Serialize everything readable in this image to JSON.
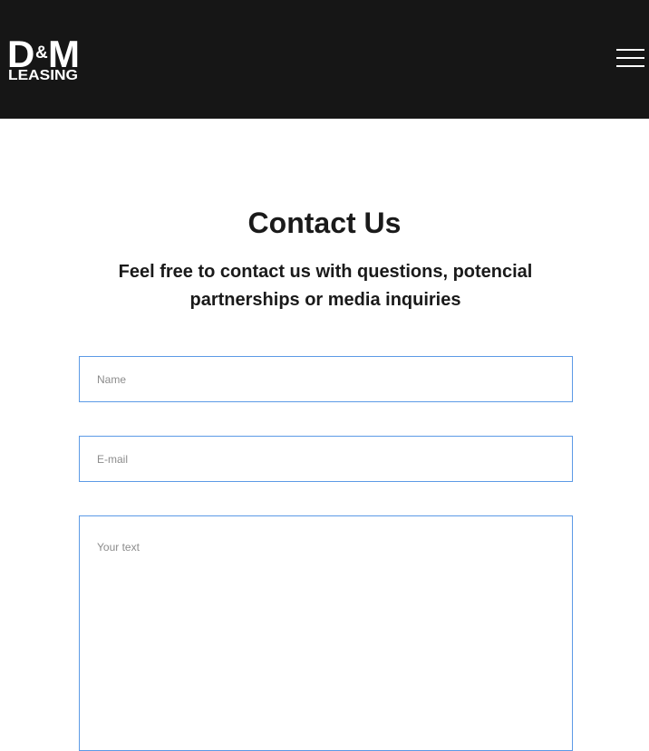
{
  "header": {
    "logo": {
      "text_top": "D&M",
      "text_bottom": "LEASING"
    },
    "menu_icon": "hamburger-menu-icon"
  },
  "contact": {
    "title": "Contact Us",
    "subtitle": "Feel free to contact us with questions, potencial partnerships or media inquiries"
  },
  "form": {
    "name": {
      "placeholder": "Name",
      "value": ""
    },
    "email": {
      "placeholder": "E-mail",
      "value": ""
    },
    "message": {
      "placeholder": "Your text",
      "value": ""
    }
  },
  "colors": {
    "header_bg": "#161616",
    "field_border": "#5c9ae6",
    "text": "#1a1a1a"
  }
}
